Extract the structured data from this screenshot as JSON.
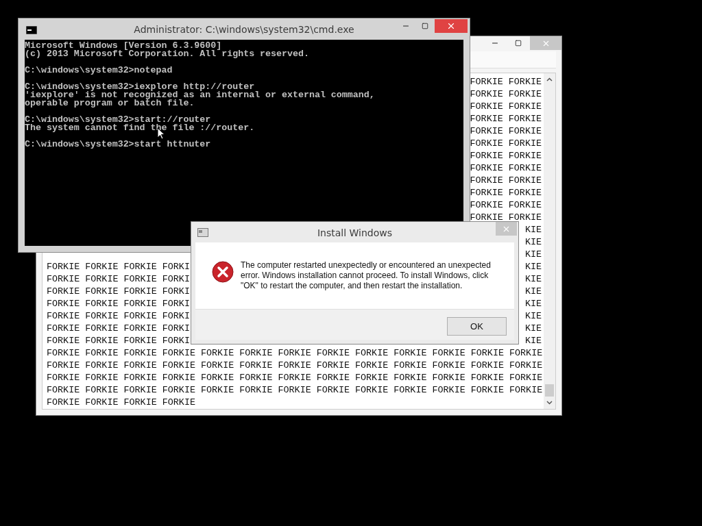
{
  "notepad": {
    "lines": [
      {
        "right": "FORKIE FORKIE"
      },
      {
        "right": "FORKIE FORKIE"
      },
      {
        "right": "FORKIE FORKIE"
      },
      {
        "right": "FORKIE FORKIE"
      },
      {
        "right": "FORKIE FORKIE"
      },
      {
        "right": "FORKIE FORKIE"
      },
      {
        "right": "FORKIE FORKIE"
      },
      {
        "right": "FORKIE FORKIE"
      },
      {
        "right": "FORKIE FORKIE"
      },
      {
        "right": "FORKIE FORKIE"
      },
      {
        "right": "FORKIE FORKIE"
      },
      {
        "right": "FORKIE FORKIE"
      },
      {
        "right": "KIE"
      },
      {
        "right": "KIE"
      },
      {
        "right": "KIE"
      },
      {
        "left": "FORKIE FORKIE FORKIE FORKI",
        "right": "KIE"
      },
      {
        "left": "FORKIE FORKIE FORKIE FORKI",
        "right": "KIE"
      },
      {
        "left": "FORKIE FORKIE FORKIE FORKI",
        "right": "KIE"
      },
      {
        "left": "FORKIE FORKIE FORKIE FORKI",
        "right": "KIE"
      },
      {
        "left": "FORKIE FORKIE FORKIE FORKI",
        "right": "KIE"
      },
      {
        "left": "FORKIE FORKIE FORKIE FORKI",
        "right": "KIE"
      },
      {
        "left": "FORKIE FORKIE FORKIE FORKI",
        "right": "KIE"
      },
      {
        "left": "FORKIE FORKIE FORKIE FORKIE FORKIE FORKIE FORKIE FORKIE FORKIE FORKIE FORKIE FORKIE FORKIE"
      },
      {
        "left": "FORKIE FORKIE FORKIE FORKIE FORKIE FORKIE FORKIE FORKIE FORKIE FORKIE FORKIE FORKIE FORKIE"
      },
      {
        "left": "FORKIE FORKIE FORKIE FORKIE FORKIE FORKIE FORKIE FORKIE FORKIE FORKIE FORKIE FORKIE FORKIE"
      },
      {
        "left": "FORKIE FORKIE FORKIE FORKIE FORKIE FORKIE FORKIE FORKIE FORKIE FORKIE FORKIE FORKIE FORKIE"
      },
      {
        "left": "FORKIE FORKIE FORKIE FORKIE"
      }
    ]
  },
  "cmd": {
    "title": "Administrator: C:\\windows\\system32\\cmd.exe",
    "blocks": [
      [
        "Microsoft Windows [Version 6.3.9600]",
        "(c) 2013 Microsoft Corporation. All rights reserved."
      ],
      [
        "C:\\windows\\system32>notepad"
      ],
      [
        "C:\\windows\\system32>iexplore http://router",
        "'iexplore' is not recognized as an internal or external command,",
        "operable program or batch file."
      ],
      [
        "C:\\windows\\system32>start://router",
        "The system cannot find the file ://router."
      ],
      [
        "C:\\windows\\system32>start httnuter"
      ]
    ]
  },
  "dialog": {
    "title": "Install Windows",
    "message": "The computer restarted unexpectedly or encountered an unexpected error. Windows installation cannot proceed. To install Windows, click \"OK\" to restart the computer, and then restart the installation.",
    "button": "OK"
  }
}
